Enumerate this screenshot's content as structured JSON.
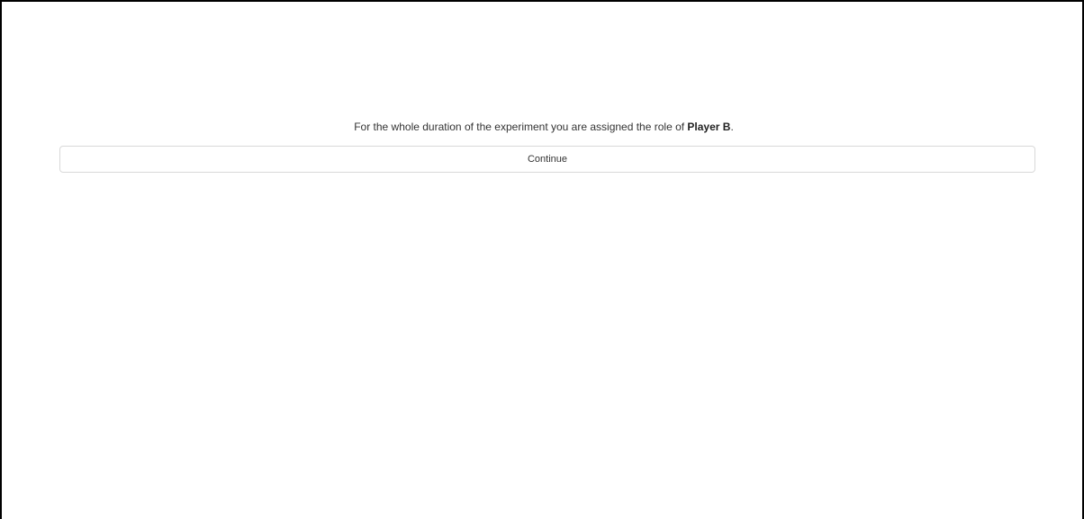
{
  "instruction": {
    "prefix": "For the whole duration of the experiment you are assigned the role of ",
    "role": "Player B",
    "suffix": "."
  },
  "actions": {
    "continue_label": "Continue"
  }
}
